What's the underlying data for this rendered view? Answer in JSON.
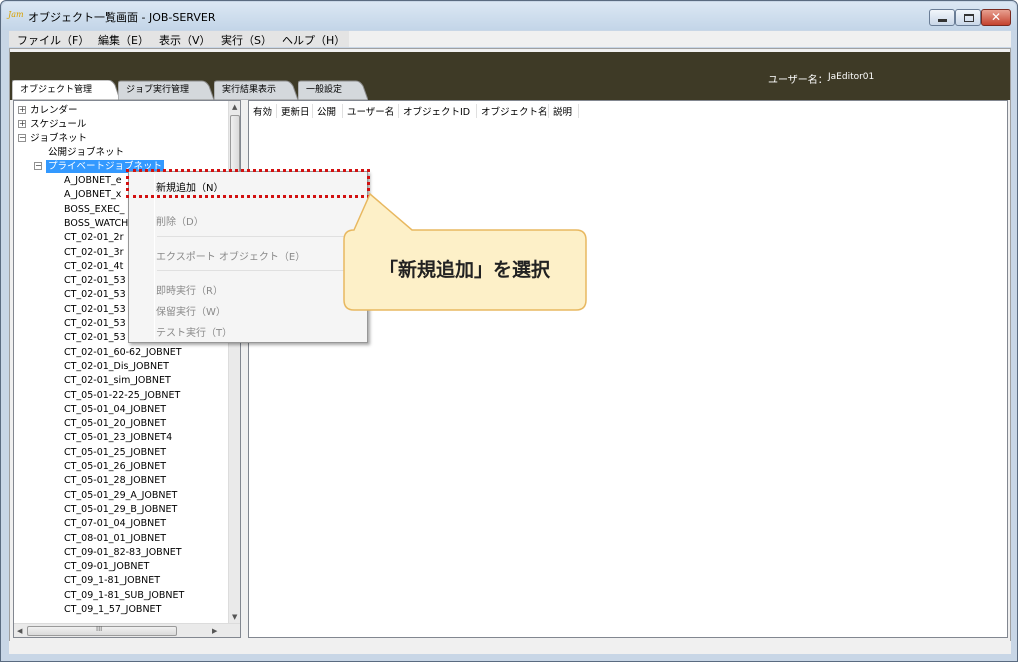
{
  "window": {
    "icon_text": "Jam",
    "title": "オブジェクト一覧画面 - JOB-SERVER",
    "close_glyph": "✕"
  },
  "menubar": {
    "items": [
      "ファイル（F）",
      "編集（E）",
      "表示（V）",
      "実行（S）",
      "ヘルプ（H）"
    ]
  },
  "header": {
    "user_label": "ユーザー名：",
    "user_name": "JaEditor01"
  },
  "tabs": [
    "オブジェクト管理",
    "ジョブ実行管理",
    "実行結果表示",
    "一般設定"
  ],
  "tree": {
    "top_nodes": [
      "カレンダー",
      "スケジュール",
      "ジョブネット"
    ],
    "public_node": "公開ジョブネット",
    "private_node": "プライベートジョブネット",
    "jobnets": [
      "A_JOBNET_e",
      "A_JOBNET_x",
      "BOSS_EXEC_",
      "BOSS_WATCH",
      "CT_02-01_2r",
      "CT_02-01_3r",
      "CT_02-01_4t",
      "CT_02-01_53",
      "CT_02-01_53",
      "CT_02-01_53",
      "CT_02-01_53",
      "CT_02-01_53",
      "CT_02-01_60-62_JOBNET",
      "CT_02-01_Dis_JOBNET",
      "CT_02-01_sim_JOBNET",
      "CT_05-01-22-25_JOBNET",
      "CT_05-01_04_JOBNET",
      "CT_05-01_20_JOBNET",
      "CT_05-01_23_JOBNET4",
      "CT_05-01_25_JOBNET",
      "CT_05-01_26_JOBNET",
      "CT_05-01_28_JOBNET",
      "CT_05-01_29_A_JOBNET",
      "CT_05-01_29_B_JOBNET",
      "CT_07-01_04_JOBNET",
      "CT_08-01_01_JOBNET",
      "CT_09-01_82-83_JOBNET",
      "CT_09-01_JOBNET",
      "CT_09_1-81_JOBNET",
      "CT_09_1-81_SUB_JOBNET",
      "CT_09_1_57_JOBNET"
    ],
    "hscroll_thumb_glyph": "III"
  },
  "grid": {
    "columns": [
      "有効",
      "更新日",
      "公開",
      "ユーザー名",
      "オブジェクトID",
      "オブジェクト名",
      "説明"
    ]
  },
  "context_menu": {
    "items": [
      {
        "label": "新規追加（N）",
        "enabled": true
      },
      {
        "label": "削除（D）",
        "enabled": false
      },
      {
        "label": "エクスポート オブジェクト（E）",
        "enabled": false
      },
      {
        "label": "即時実行（R）",
        "enabled": false
      },
      {
        "label": "保留実行（W）",
        "enabled": false
      },
      {
        "label": "テスト実行（T）",
        "enabled": false
      }
    ]
  },
  "callout": {
    "text": "「新規追加」を選択",
    "fill_color": "#fdf0c8",
    "border_color": "#e8b860",
    "highlight_color": "#d21010"
  }
}
